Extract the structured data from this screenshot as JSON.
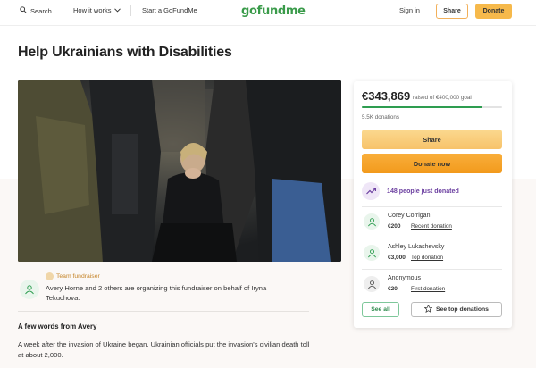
{
  "header": {
    "search_label": "Search",
    "how_it_works_label": "How it works",
    "start_label": "Start a GoFundMe",
    "logo_text": "gofundme",
    "signin_label": "Sign in",
    "share_label": "Share",
    "donate_label": "Donate"
  },
  "campaign": {
    "title": "Help Ukrainians with Disabilities"
  },
  "organizer": {
    "badge": "Team fundraiser",
    "text": "Avery Horne and 2 others are organizing this fundraiser on behalf of Iryna Tekuchova."
  },
  "story": {
    "heading": "A few words from Avery",
    "paragraph": "A week after the invasion of Ukraine began, Ukrainian officials put the invasion's civilian death toll at about 2,000."
  },
  "donation_card": {
    "raised": "€343,869",
    "goal_text": "raised of €400,000 goal",
    "progress_fraction": 0.86,
    "donation_count": "5.5K donations",
    "share_label": "Share",
    "donate_label": "Donate now",
    "just_donated": "148 people just donated",
    "donors": [
      {
        "name": "Corey Corrigan",
        "amount": "€200",
        "type": "Recent donation",
        "icon": "donor-hands-icon",
        "color": "#2e9d50"
      },
      {
        "name": "Ashley Lukashevsky",
        "amount": "€3,000",
        "type": "Top donation",
        "icon": "donor-hands-icon",
        "color": "#2e9d50"
      },
      {
        "name": "Anonymous",
        "amount": "€20",
        "type": "First donation",
        "icon": "donor-hands-icon",
        "color": "#555555"
      }
    ],
    "see_all_label": "See all",
    "see_top_label": "See top donations"
  },
  "colors": {
    "brand_green": "#3a9b4a",
    "donate_orange": "#f29a1c",
    "share_yellow": "#f7c36a",
    "just_donated_purple": "#6b3fa0"
  }
}
